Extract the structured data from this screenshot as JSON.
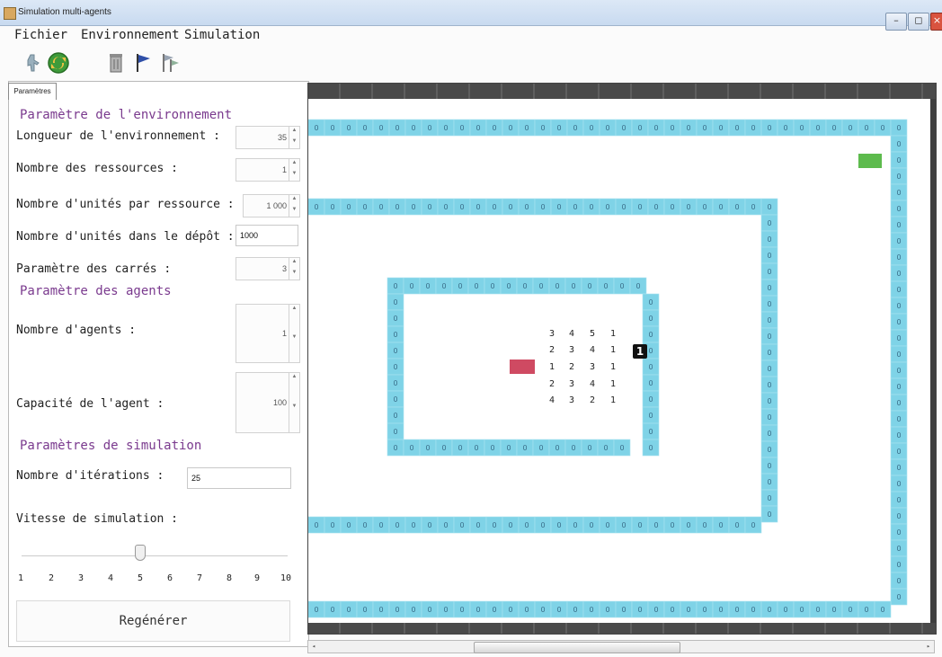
{
  "window": {
    "title": "Simulation multi-agents"
  },
  "menu": {
    "items": [
      "Fichier",
      "Environnement",
      "Simulation"
    ]
  },
  "toolbar": {
    "icons": [
      "agent-icon",
      "refresh-icon",
      "trash-icon",
      "flag-icon",
      "flags-icon"
    ]
  },
  "tab": {
    "label": "Paramètres"
  },
  "params": {
    "env_section": "Paramètre de l'environnement",
    "env_length_label": "Longueur de l'environnement :",
    "env_length_value": "35",
    "resources_label": "Nombre des ressources :",
    "resources_value": "1",
    "units_per_resource_label": "Nombre d'unités par ressource :",
    "units_per_resource_value": "1 000",
    "units_in_depot_label": "Nombre d'unités dans le dépôt :",
    "units_in_depot_value": "1000",
    "squares_label": "Paramètre des carrés :",
    "squares_value": "3",
    "agents_section": "Paramètre des agents",
    "agents_count_label": "Nombre d'agents :",
    "agents_count_value": "1",
    "agent_capacity_label": "Capacité de l'agent :",
    "agent_capacity_value": "100",
    "sim_section": "Paramètres de simulation",
    "iterations_label": "Nombre d'itérations :",
    "iterations_value": "25",
    "speed_label": "Vitesse de simulation :",
    "speed_ticks": [
      "1",
      "2",
      "3",
      "4",
      "5",
      "6",
      "7",
      "8",
      "9",
      "10"
    ],
    "speed_value": 5,
    "regenerate_label": "Regénérer"
  },
  "grid": {
    "cell_value": "0",
    "agent_label": "1",
    "colors": {
      "corridor": "#7fd3e7",
      "resource": "#cf4a62",
      "depot": "#5dbb4d",
      "agent_bg": "#111111"
    },
    "matrix": [
      [
        "3",
        "4",
        "5",
        "1"
      ],
      [
        "2",
        "3",
        "4",
        "1"
      ],
      [
        "1",
        "2",
        "3",
        "1"
      ],
      [
        "2",
        "3",
        "4",
        "1"
      ],
      [
        "4",
        "3",
        "2",
        "1"
      ]
    ]
  }
}
